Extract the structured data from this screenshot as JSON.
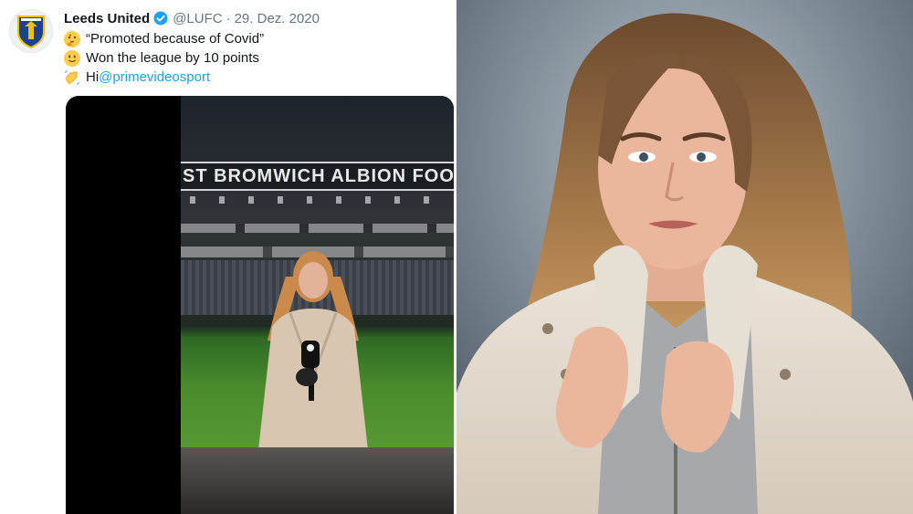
{
  "tweet": {
    "display_name": "Leeds United",
    "handle": "@LUFC",
    "separator": "·",
    "date": "29. Dez. 2020",
    "lines": [
      {
        "emoji": "thinking-face-emoji",
        "text": "“Promoted because of Covid”"
      },
      {
        "emoji": "slightly-smiling-face-emoji",
        "text": "Won the league by 10 points"
      },
      {
        "emoji": "waving-hand-emoji",
        "text": "Hi ",
        "mention": "@primevideosport"
      }
    ]
  },
  "video": {
    "stadium_banner": "ST BROMWICH ALBION FOOTB"
  },
  "colors": {
    "mention": "#1da1f2",
    "verified": "#1da1f2",
    "muted": "#657786"
  }
}
